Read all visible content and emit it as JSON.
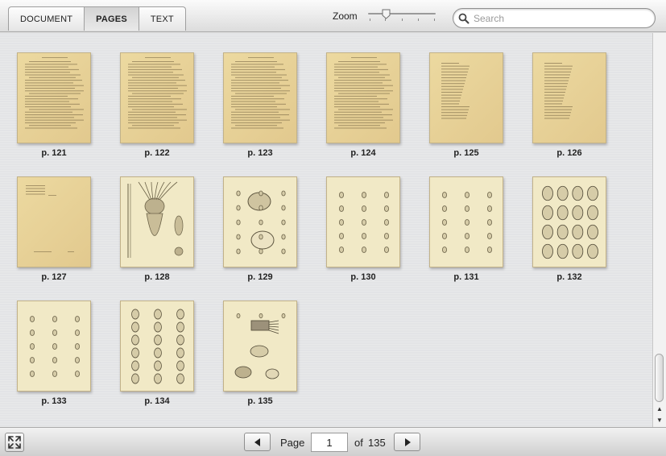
{
  "tabs": [
    {
      "label": "DOCUMENT",
      "active": false
    },
    {
      "label": "PAGES",
      "active": true
    },
    {
      "label": "TEXT",
      "active": false
    }
  ],
  "zoom": {
    "label": "Zoom",
    "level": 0.25
  },
  "search": {
    "placeholder": "Search",
    "value": "",
    "icon": "search-icon"
  },
  "pages": [
    {
      "label": "p. 121",
      "kind": "text"
    },
    {
      "label": "p. 122",
      "kind": "text"
    },
    {
      "label": "p. 123",
      "kind": "text"
    },
    {
      "label": "p. 124",
      "kind": "text"
    },
    {
      "label": "p. 125",
      "kind": "list"
    },
    {
      "label": "p. 126",
      "kind": "list"
    },
    {
      "label": "p. 127",
      "kind": "sparse"
    },
    {
      "label": "p. 128",
      "kind": "plate-squid"
    },
    {
      "label": "p. 129",
      "kind": "plate-shells"
    },
    {
      "label": "p. 130",
      "kind": "plate-small-shells"
    },
    {
      "label": "p. 131",
      "kind": "plate-small-shells"
    },
    {
      "label": "p. 132",
      "kind": "plate-round-shells"
    },
    {
      "label": "p. 133",
      "kind": "plate-small-shells"
    },
    {
      "label": "p. 134",
      "kind": "plate-shells-grid"
    },
    {
      "label": "p. 135",
      "kind": "plate-crabs"
    }
  ],
  "pager": {
    "page_label": "Page",
    "current": "1",
    "of_label": "of",
    "total": "135"
  },
  "colors": {
    "page_text": "#e6d6a4",
    "page_plate": "#f1e9c6",
    "background": "#e3e4e6"
  }
}
